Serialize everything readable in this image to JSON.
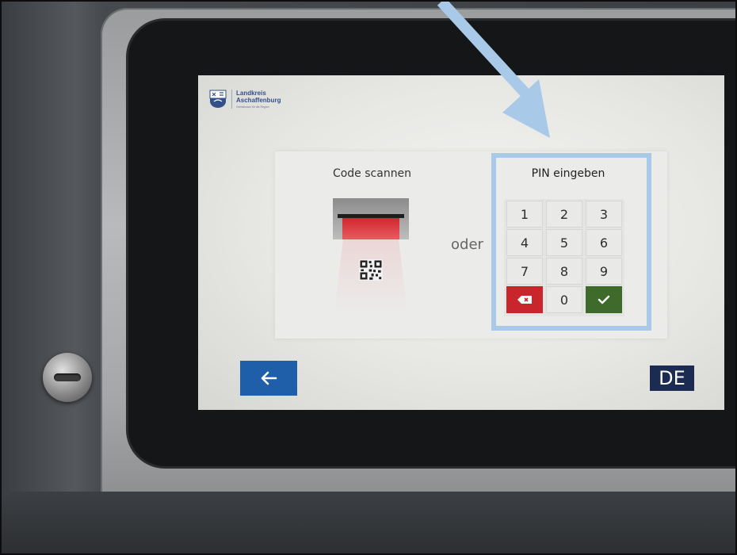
{
  "logo": {
    "title": "Landkreis\nAschaffenburg",
    "subtitle": "Gemeinsam für die Region"
  },
  "scan": {
    "title": "Code scannen"
  },
  "separator": {
    "label": "oder"
  },
  "pin": {
    "title": "PIN eingeben",
    "keys": [
      "1",
      "2",
      "3",
      "4",
      "5",
      "6",
      "7",
      "8",
      "9",
      "0"
    ],
    "delete_icon": "backspace-icon",
    "confirm_icon": "checkmark-icon"
  },
  "nav": {
    "back_icon": "arrow-left-icon",
    "language": "DE"
  },
  "colors": {
    "primary_blue": "#1f5ea8",
    "lang_bg": "#1b2b52",
    "delete_red": "#c8262c",
    "confirm_green": "#3e6b2c",
    "highlight": "#a9c9e8"
  }
}
